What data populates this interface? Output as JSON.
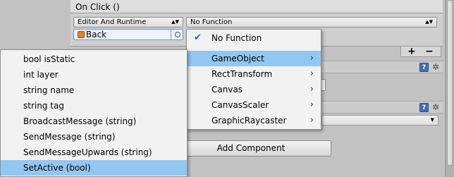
{
  "event": {
    "header": "On Click ()",
    "call_state": "Editor And Runtime",
    "function_label": "No Function",
    "target_object": "Back"
  },
  "list_controls": {
    "add": "+",
    "remove": "−"
  },
  "add_component_label": "Add Component",
  "function_menu": {
    "items": [
      {
        "label": "No Function",
        "checked": true,
        "has_submenu": false
      },
      {
        "label": "GameObject",
        "checked": false,
        "has_submenu": true,
        "highlighted": true
      },
      {
        "label": "RectTransform",
        "checked": false,
        "has_submenu": true
      },
      {
        "label": "Canvas",
        "checked": false,
        "has_submenu": true
      },
      {
        "label": "CanvasScaler",
        "checked": false,
        "has_submenu": true
      },
      {
        "label": "GraphicRaycaster",
        "checked": false,
        "has_submenu": true
      }
    ]
  },
  "gameobject_submenu": {
    "items": [
      {
        "label": "bool isStatic"
      },
      {
        "label": "int layer"
      },
      {
        "label": "string name"
      },
      {
        "label": "string tag"
      },
      {
        "label": "BroadcastMessage (string)"
      },
      {
        "label": "SendMessage (string)"
      },
      {
        "label": "SendMessageUpwards (string)"
      },
      {
        "label": "SetActive (bool)",
        "highlighted": true
      }
    ]
  },
  "icons": {
    "check": "checkmark-icon",
    "submenu": "chevron-right-icon",
    "help": "help-book-icon",
    "settings": "gear-icon",
    "object": "gameobject-cube-icon",
    "picker": "object-picker-icon"
  },
  "colors": {
    "highlight": "#92c7f2",
    "menu_background": "#f2f2f2",
    "inspector_background": "#c2c2c2"
  }
}
